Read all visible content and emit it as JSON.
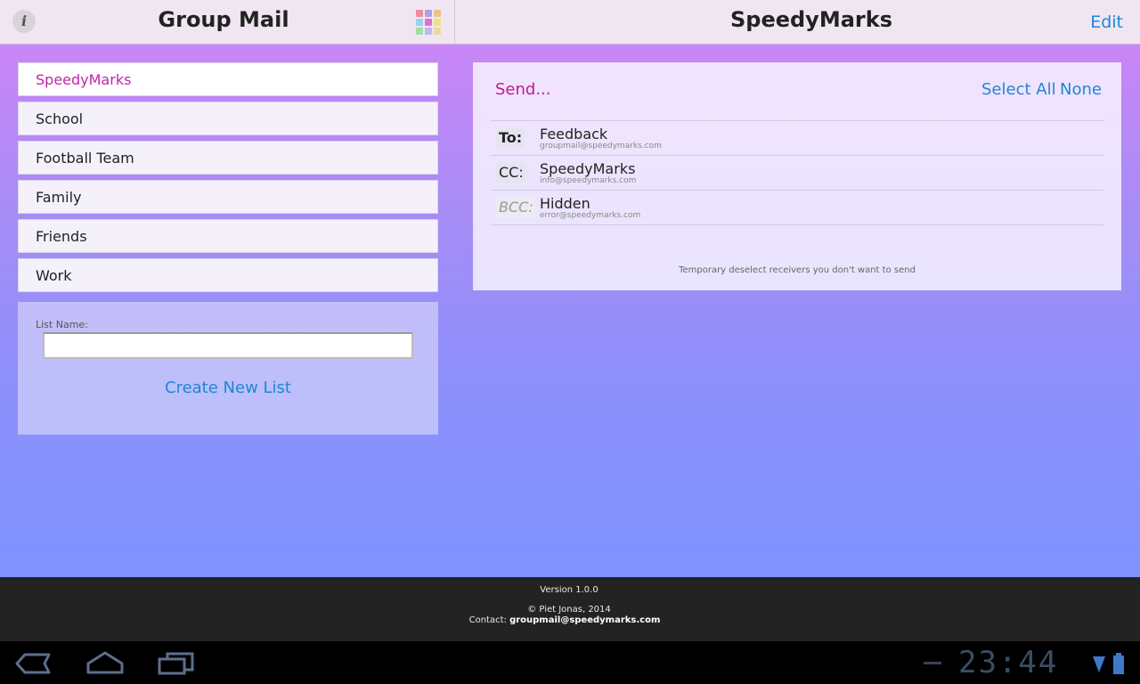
{
  "header": {
    "app_title": "Group Mail",
    "info_label": "i",
    "list_title": "SpeedyMarks",
    "edit_label": "Edit"
  },
  "lists": [
    {
      "label": "SpeedyMarks",
      "selected": true
    },
    {
      "label": "School",
      "selected": false
    },
    {
      "label": "Football Team",
      "selected": false
    },
    {
      "label": "Family",
      "selected": false
    },
    {
      "label": "Friends",
      "selected": false
    },
    {
      "label": "Work",
      "selected": false
    }
  ],
  "create_list": {
    "label": "List Name:",
    "input_value": "",
    "button_label": "Create New List"
  },
  "send_panel": {
    "send_label": "Send...",
    "select_all_label": "Select All",
    "none_label": "None",
    "recipients": [
      {
        "type": "To:",
        "name": "Feedback",
        "email": "groupmail@speedymarks.com"
      },
      {
        "type": "CC:",
        "name": "SpeedyMarks",
        "email": "info@speedymarks.com"
      },
      {
        "type": "BCC:",
        "name": "Hidden",
        "email": "error@speedymarks.com"
      }
    ],
    "hint": "Temporary deselect receivers you don't want to send"
  },
  "footer": {
    "version": "Version 1.0.0",
    "copyright": "© Piet Jonas, 2014",
    "contact_label": "Contact:",
    "contact_email": "groupmail@speedymarks.com"
  },
  "system_bar": {
    "clock": "23:44",
    "icons": [
      "back-icon",
      "home-icon",
      "recent-apps-icon",
      "wifi-icon",
      "battery-icon"
    ]
  },
  "colors": {
    "accent_blue": "#1f86d6",
    "accent_magenta": "#c21b86",
    "gradient_top": "#c985f6",
    "gradient_bottom": "#7f93ff"
  }
}
